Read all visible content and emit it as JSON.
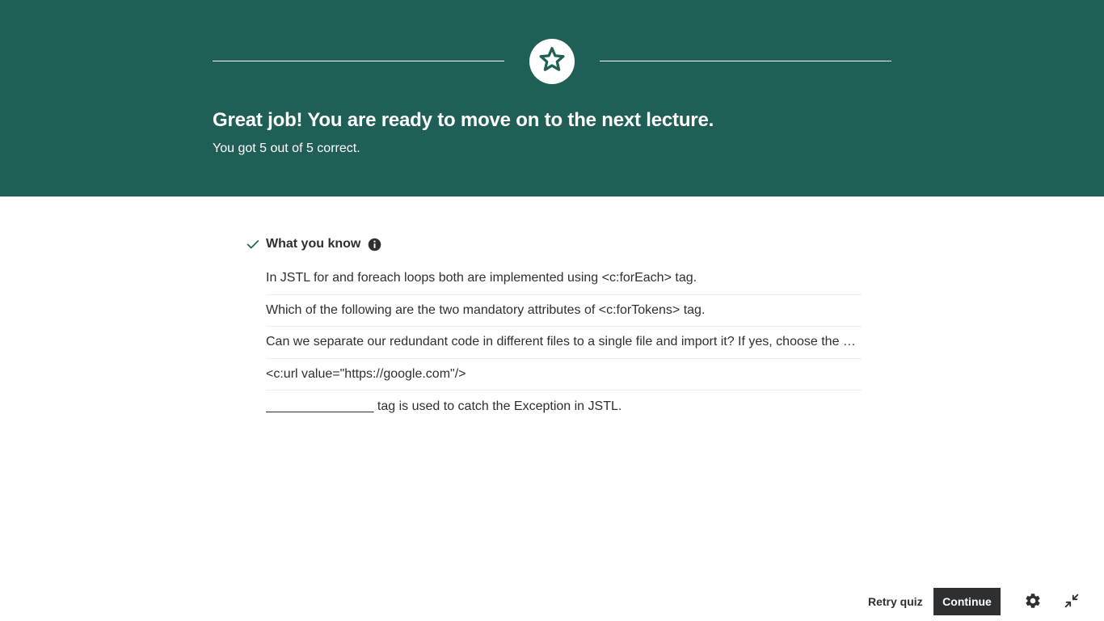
{
  "banner": {
    "title": "Great job! You are ready to move on to the next lecture.",
    "score_text": "You got 5 out of 5 correct.",
    "badge_icon": "star-icon",
    "background_color": "#1f5f56"
  },
  "knowledge": {
    "heading": "What you know",
    "status_icon": "check-icon",
    "info_icon": "info-icon",
    "questions": [
      "In JSTL for and foreach loops both are implemented using <c:forEach> tag.",
      "Which of the following are the two mandatory attributes of <c:forTokens> tag.",
      "Can we separate our redundant code in different files to a single file and import it? If yes, choose the correct tag.",
      "<c:url value=\"https://google.com\"/>",
      "_______________ tag is used to catch the Exception in JSTL."
    ]
  },
  "footer": {
    "retry_label": "Retry quiz",
    "continue_label": "Continue",
    "settings_icon": "gear-icon",
    "collapse_icon": "collapse-icon"
  },
  "colors": {
    "accent_green": "#1f5f56",
    "check_green": "#1e6055",
    "text_dark": "#2d2f31"
  }
}
